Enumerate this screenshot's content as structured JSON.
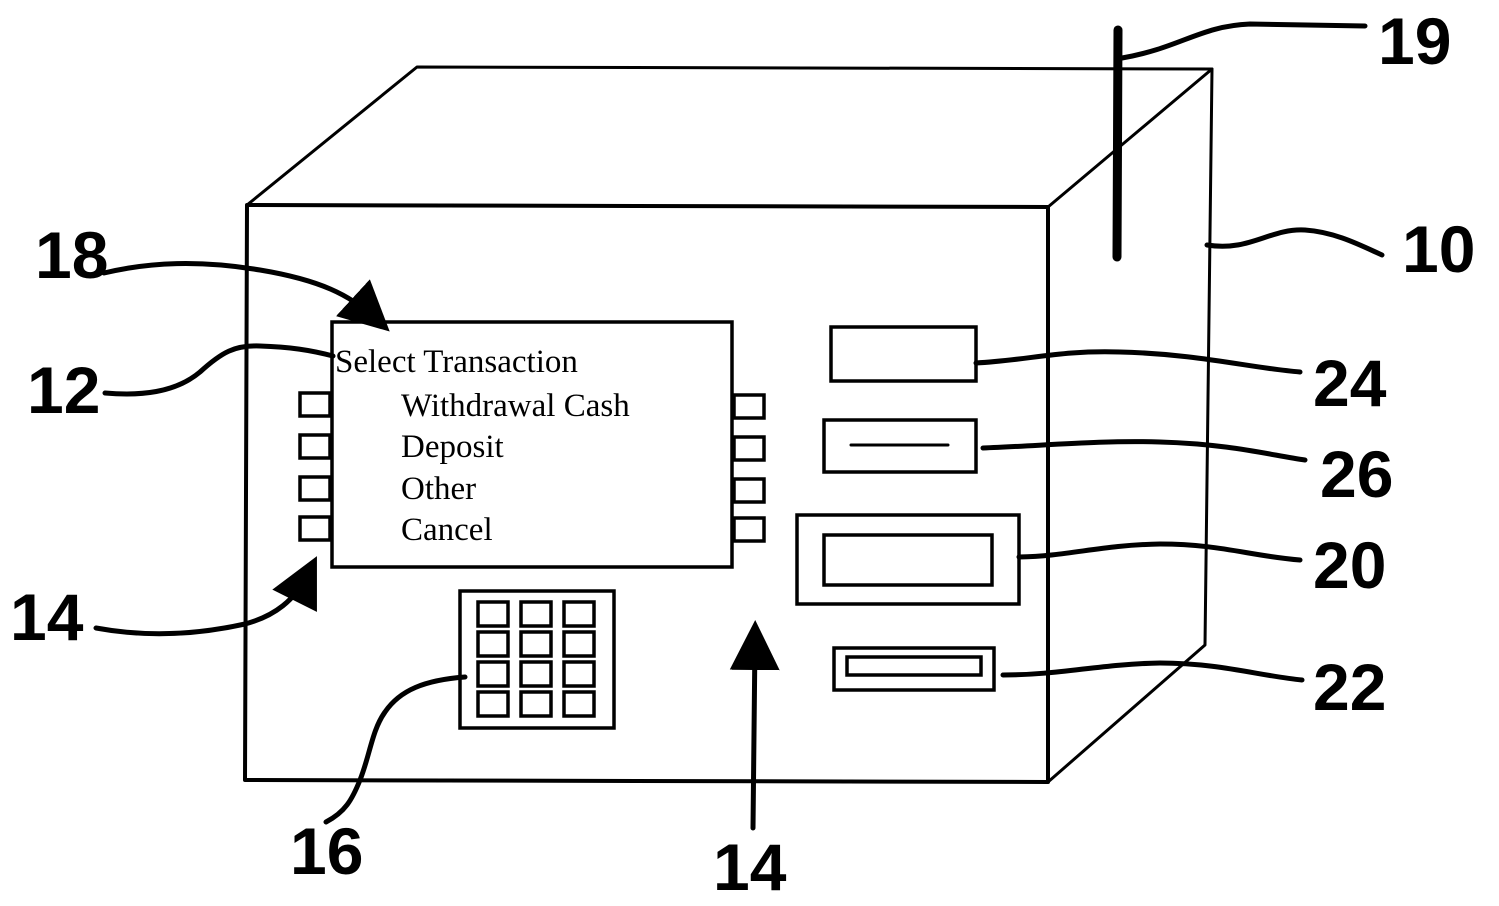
{
  "figure": {
    "description": "Automated teller machine (ATM) perspective drawing with reference numerals",
    "screen": {
      "title": "Select Transaction",
      "options": [
        "Withdrawal Cash",
        "Deposit",
        "Other",
        "Cancel"
      ]
    },
    "reference_numerals": {
      "housing": "10",
      "display": "12",
      "function_keys_left": "14",
      "function_keys_bottom": "14",
      "keypad": "16",
      "screen_pointer": "18",
      "antenna": "19",
      "cash_dispenser": "20",
      "card_reader": "22",
      "receipt_printer": "24",
      "deposit_slot": "26"
    },
    "keypad": {
      "rows": 4,
      "cols": 3
    },
    "function_keys": {
      "left_count": 4,
      "right_count": 4
    },
    "colors": {
      "ink": "#000000",
      "paper": "#ffffff"
    }
  }
}
